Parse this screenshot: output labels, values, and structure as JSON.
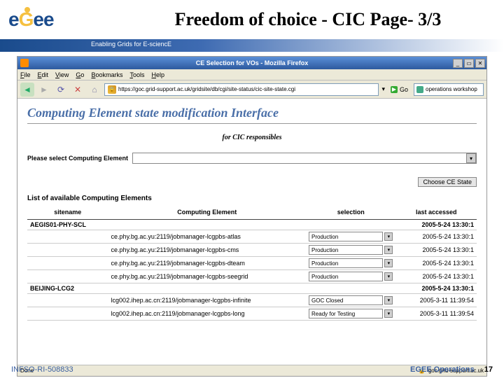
{
  "slide": {
    "title": "Freedom of choice -  CIC Page- 3/3",
    "tagline": "Enabling Grids for E-sciencE",
    "footer_left": "INFSO-RI-508833",
    "footer_right": "EGEE Operations",
    "footer_page": "17"
  },
  "browser": {
    "window_title": "CE Selection for VOs - Mozilla Firefox",
    "menu": {
      "file": "File",
      "edit": "Edit",
      "view": "View",
      "go": "Go",
      "bookmarks": "Bookmarks",
      "tools": "Tools",
      "help": "Help"
    },
    "url": "https://goc.grid-support.ac.uk/gridsite/db/cgi/site-status/cic-site-state.cgi",
    "go_label": "Go",
    "search_placeholder": "operations workshop",
    "status_left": "Done",
    "status_right": "goc.grid-support.ac.uk"
  },
  "page": {
    "title": "Computing Element state modification Interface",
    "subtitle": "for CIC responsibles",
    "select_label": "Please select Computing Element",
    "choose_btn": "Choose CE State",
    "list_title": "List of available Computing Elements",
    "columns": {
      "site": "sitename",
      "ce": "Computing Element",
      "selection": "selection",
      "last": "last accessed"
    }
  },
  "rows": [
    {
      "type": "site",
      "site": "AEGIS01-PHY-SCL",
      "last": "2005-5-24 13:30:1"
    },
    {
      "type": "ce",
      "ce": "ce.phy.bg.ac.yu:2119/jobmanager-lcgpbs-atlas",
      "selection": "Production",
      "last": "2005-5-24 13:30:1"
    },
    {
      "type": "ce",
      "ce": "ce.phy.bg.ac.yu:2119/jobmanager-lcgpbs-cms",
      "selection": "Production",
      "last": "2005-5-24 13:30:1"
    },
    {
      "type": "ce",
      "ce": "ce.phy.bg.ac.yu:2119/jobmanager-lcgpbs-dteam",
      "selection": "Production",
      "last": "2005-5-24 13:30:1"
    },
    {
      "type": "ce",
      "ce": "ce.phy.bg.ac.yu:2119/jobmanager-lcgpbs-seegrid",
      "selection": "Production",
      "last": "2005-5-24 13:30:1"
    },
    {
      "type": "site",
      "site": "BEIJING-LCG2",
      "last": "2005-5-24 13:30:1"
    },
    {
      "type": "ce",
      "ce": "lcg002.ihep.ac.cn:2119/jobmanager-lcgpbs-infinite",
      "selection": "GOC Closed",
      "last": "2005-3-11 11:39:54"
    },
    {
      "type": "ce",
      "ce": "lcg002.ihep.ac.cn:2119/jobmanager-lcgpbs-long",
      "selection": "Ready for Testing",
      "last": "2005-3-11 11:39:54"
    }
  ]
}
